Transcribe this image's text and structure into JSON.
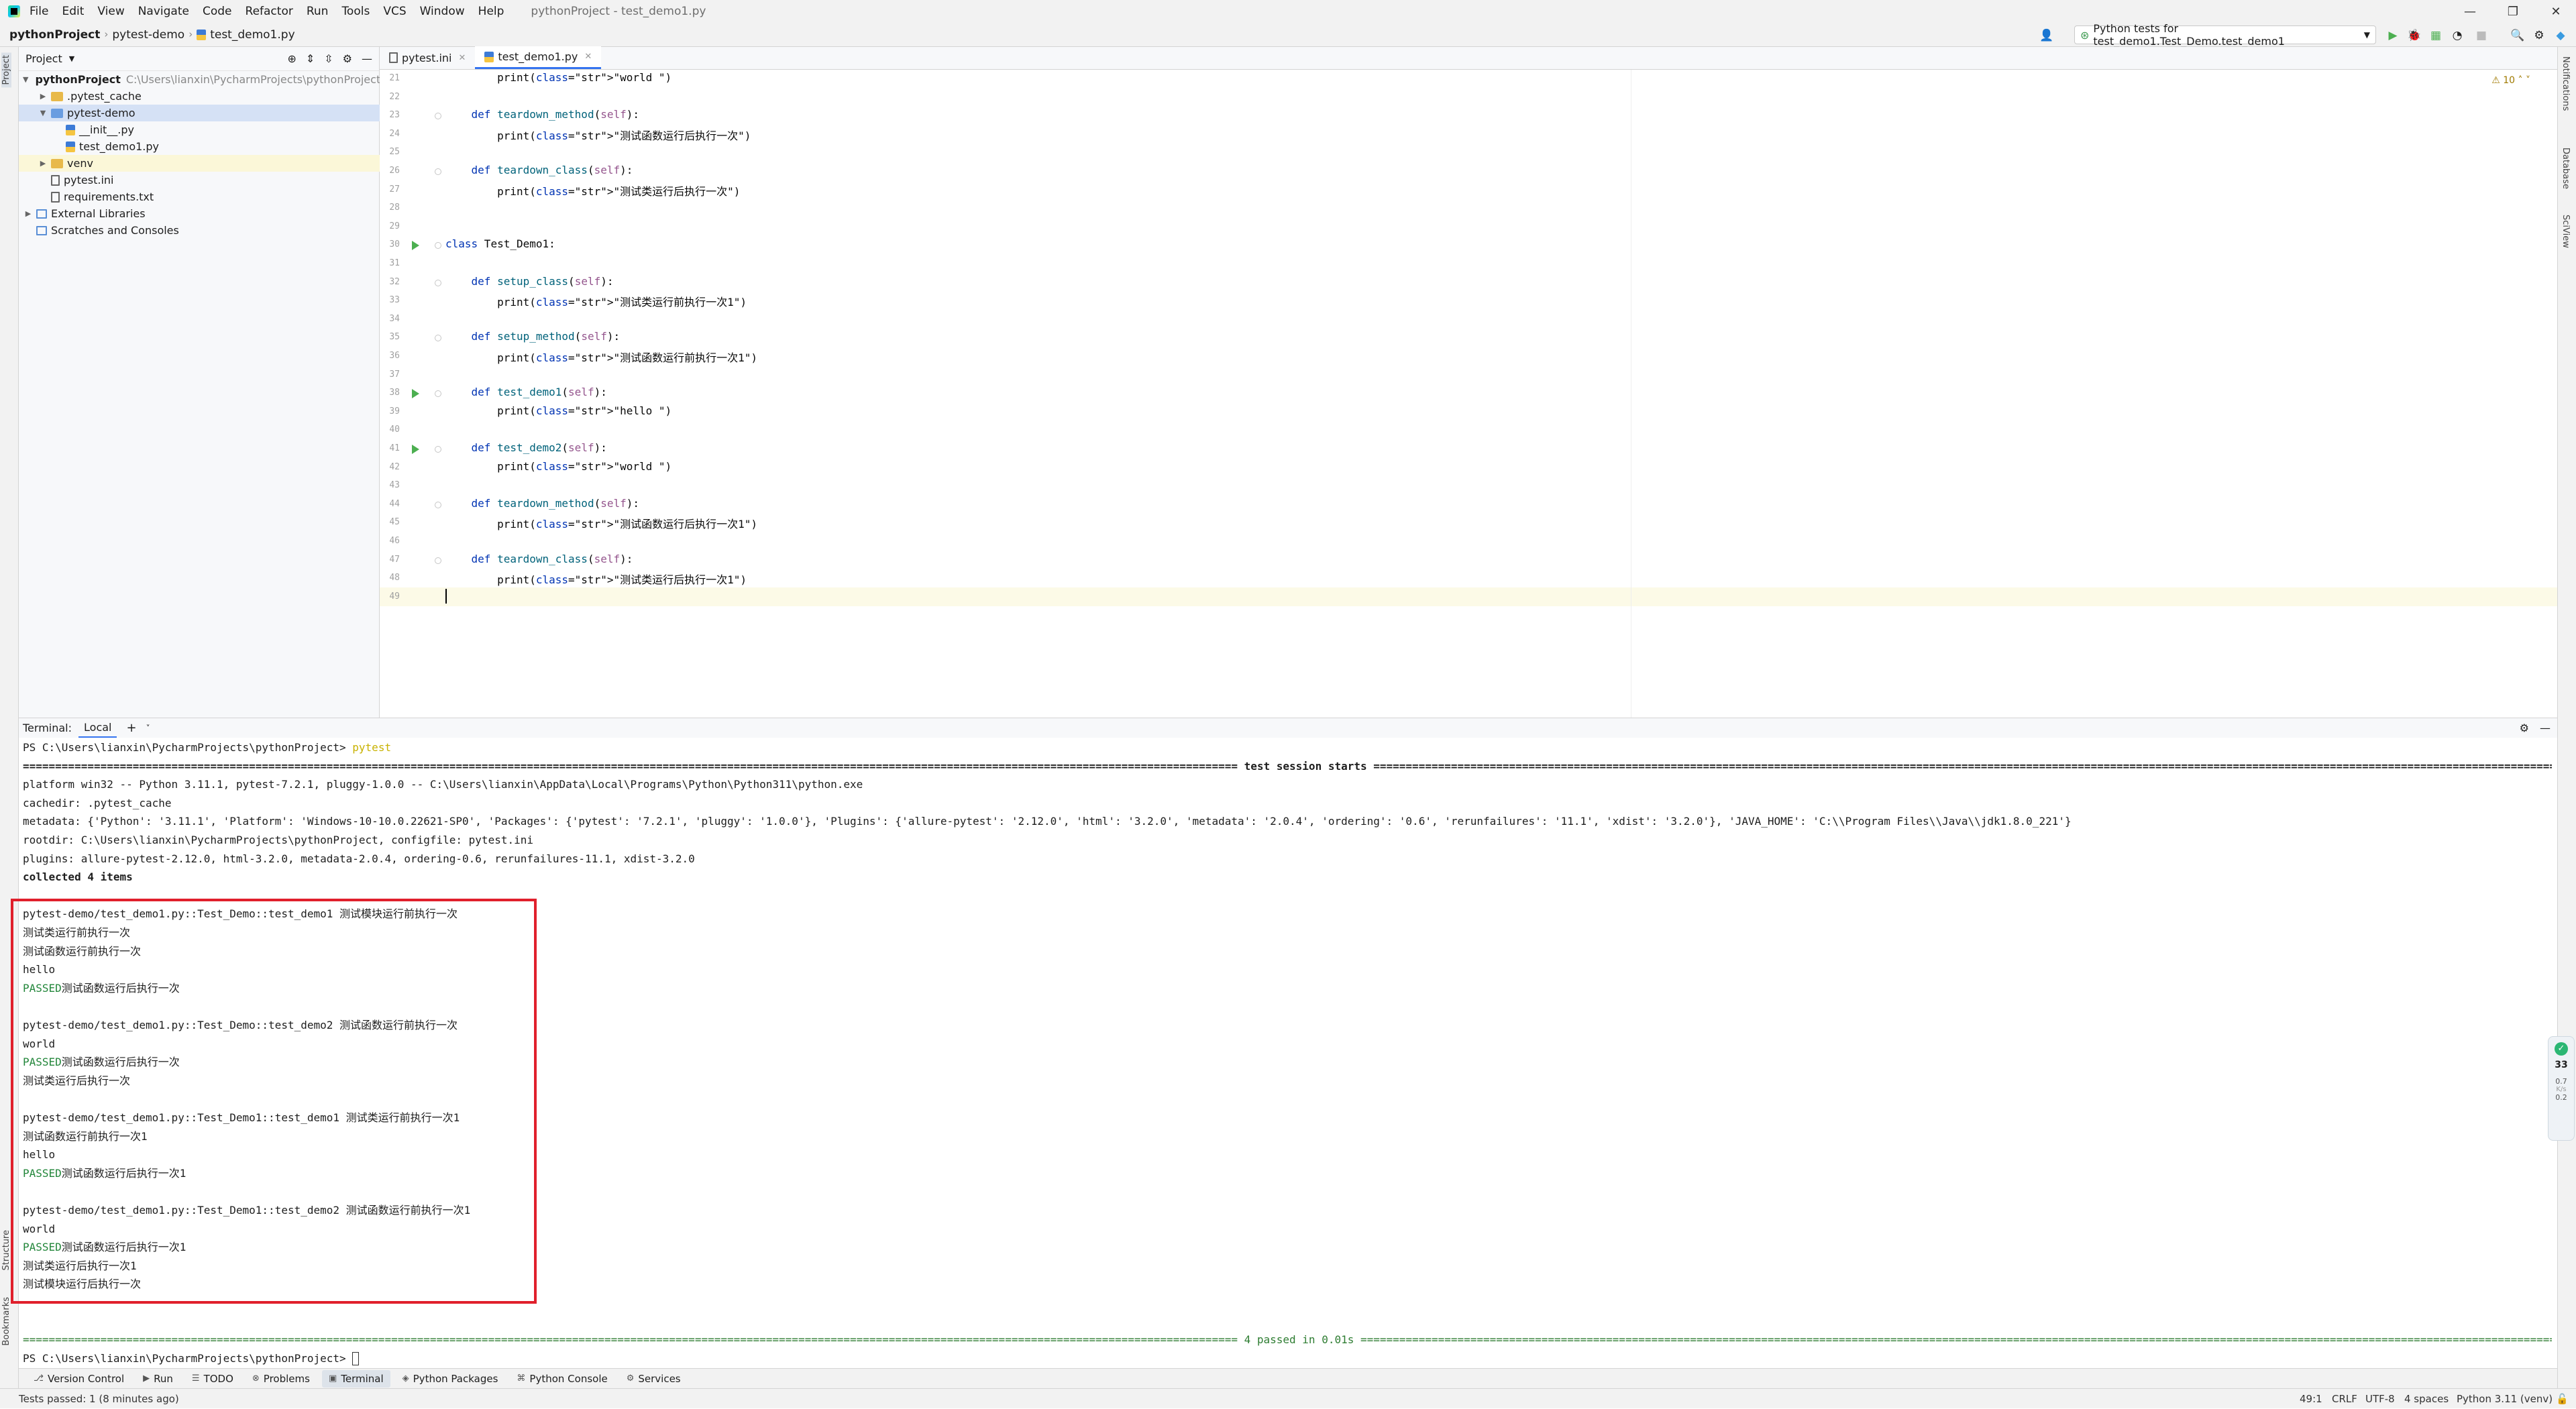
{
  "window": {
    "title": "pythonProject - test_demo1.py",
    "menu": [
      "File",
      "Edit",
      "View",
      "Navigate",
      "Code",
      "Refactor",
      "Run",
      "Tools",
      "VCS",
      "Window",
      "Help"
    ]
  },
  "breadcrumb": [
    "pythonProject",
    "pytest-demo",
    "test_demo1.py"
  ],
  "run_config": "Python tests for test_demo1.Test_Demo.test_demo1",
  "project_panel": {
    "title": "Project",
    "tree": [
      {
        "label": "pythonProject",
        "path": "C:\\Users\\lianxin\\PycharmProjects\\pythonProject",
        "kind": "folder",
        "open": true
      },
      {
        "label": ".pytest_cache",
        "kind": "folder"
      },
      {
        "label": "pytest-demo",
        "kind": "folder",
        "open": true
      },
      {
        "label": "__init__.py",
        "kind": "py"
      },
      {
        "label": "test_demo1.py",
        "kind": "py"
      },
      {
        "label": "venv",
        "kind": "folder"
      },
      {
        "label": "pytest.ini",
        "kind": "ini"
      },
      {
        "label": "requirements.txt",
        "kind": "txt"
      },
      {
        "label": "External Libraries",
        "kind": "lib"
      },
      {
        "label": "Scratches and Consoles",
        "kind": "scratch"
      }
    ]
  },
  "editor": {
    "tabs": [
      {
        "label": "pytest.ini",
        "active": false
      },
      {
        "label": "test_demo1.py",
        "active": true
      }
    ],
    "warnings": "10",
    "lines": [
      {
        "n": "21",
        "code": "        print(\"world \")"
      },
      {
        "n": "22",
        "code": ""
      },
      {
        "n": "23",
        "code": "    def teardown_method(self):"
      },
      {
        "n": "24",
        "code": "        print(\"测试函数运行后执行一次\")"
      },
      {
        "n": "25",
        "code": ""
      },
      {
        "n": "26",
        "code": "    def teardown_class(self):"
      },
      {
        "n": "27",
        "code": "        print(\"测试类运行后执行一次\")"
      },
      {
        "n": "28",
        "code": ""
      },
      {
        "n": "29",
        "code": ""
      },
      {
        "n": "30",
        "code": "class Test_Demo1:"
      },
      {
        "n": "31",
        "code": ""
      },
      {
        "n": "32",
        "code": "    def setup_class(self):"
      },
      {
        "n": "33",
        "code": "        print(\"测试类运行前执行一次1\")"
      },
      {
        "n": "34",
        "code": ""
      },
      {
        "n": "35",
        "code": "    def setup_method(self):"
      },
      {
        "n": "36",
        "code": "        print(\"测试函数运行前执行一次1\")"
      },
      {
        "n": "37",
        "code": ""
      },
      {
        "n": "38",
        "code": "    def test_demo1(self):"
      },
      {
        "n": "39",
        "code": "        print(\"hello \")"
      },
      {
        "n": "40",
        "code": ""
      },
      {
        "n": "41",
        "code": "    def test_demo2(self):"
      },
      {
        "n": "42",
        "code": "        print(\"world \")"
      },
      {
        "n": "43",
        "code": ""
      },
      {
        "n": "44",
        "code": "    def teardown_method(self):"
      },
      {
        "n": "45",
        "code": "        print(\"测试函数运行后执行一次1\")"
      },
      {
        "n": "46",
        "code": ""
      },
      {
        "n": "47",
        "code": "    def teardown_class(self):"
      },
      {
        "n": "48",
        "code": "        print(\"测试类运行后执行一次1\")"
      },
      {
        "n": "49",
        "code": ""
      }
    ]
  },
  "terminal": {
    "label": "Terminal:",
    "tab": "Local",
    "lines": [
      {
        "t": "PS C:\\Users\\lianxin\\PycharmProjects\\pythonProject> ",
        "cmd": "pytest"
      },
      {
        "t": "============================================================================================================================================================================================ test session starts =============================================================================================================================================================================================",
        "bold": true
      },
      {
        "t": "platform win32 -- Python 3.11.1, pytest-7.2.1, pluggy-1.0.0 -- C:\\Users\\lianxin\\AppData\\Local\\Programs\\Python\\Python311\\python.exe"
      },
      {
        "t": "cachedir: .pytest_cache"
      },
      {
        "t": "metadata: {'Python': '3.11.1', 'Platform': 'Windows-10-10.0.22621-SP0', 'Packages': {'pytest': '7.2.1', 'pluggy': '1.0.0'}, 'Plugins': {'allure-pytest': '2.12.0', 'html': '3.2.0', 'metadata': '2.0.4', 'ordering': '0.6', 'rerunfailures': '11.1', 'xdist': '3.2.0'}, 'JAVA_HOME': 'C:\\\\Program Files\\\\Java\\\\jdk1.8.0_221'}"
      },
      {
        "t": "rootdir: C:\\Users\\lianxin\\PycharmProjects\\pythonProject, configfile: pytest.ini"
      },
      {
        "t": "plugins: allure-pytest-2.12.0, html-3.2.0, metadata-2.0.4, ordering-0.6, rerunfailures-11.1, xdist-3.2.0"
      },
      {
        "t": "collected 4 items",
        "bold": true
      },
      {
        "t": ""
      },
      {
        "t": "pytest-demo/test_demo1.py::Test_Demo::test_demo1 测试模块运行前执行一次"
      },
      {
        "t": "测试类运行前执行一次"
      },
      {
        "t": "测试函数运行前执行一次"
      },
      {
        "t": "hello"
      },
      {
        "t": "测试函数运行后执行一次",
        "pass": "PASSED"
      },
      {
        "t": ""
      },
      {
        "t": "pytest-demo/test_demo1.py::Test_Demo::test_demo2 测试函数运行前执行一次"
      },
      {
        "t": "world"
      },
      {
        "t": "测试函数运行后执行一次",
        "pass": "PASSED"
      },
      {
        "t": "测试类运行后执行一次"
      },
      {
        "t": ""
      },
      {
        "t": "pytest-demo/test_demo1.py::Test_Demo1::test_demo1 测试类运行前执行一次1"
      },
      {
        "t": "测试函数运行前执行一次1"
      },
      {
        "t": "hello"
      },
      {
        "t": "测试函数运行后执行一次1",
        "pass": "PASSED"
      },
      {
        "t": ""
      },
      {
        "t": "pytest-demo/test_demo1.py::Test_Demo1::test_demo2 测试函数运行前执行一次1"
      },
      {
        "t": "world"
      },
      {
        "t": "测试函数运行后执行一次1",
        "pass": "PASSED"
      },
      {
        "t": "测试类运行后执行一次1"
      },
      {
        "t": "测试模块运行后执行一次"
      },
      {
        "t": ""
      },
      {
        "t": ""
      },
      {
        "t": "============================================================================================================================================================================================ 4 passed in 0.01s =============================================================================================================================================================================================",
        "green": true
      },
      {
        "t": "PS C:\\Users\\lianxin\\PycharmProjects\\pythonProject> ",
        "cursor": true
      }
    ]
  },
  "tool_windows": [
    {
      "label": "Version Control",
      "icon": "⎇"
    },
    {
      "label": "Run",
      "icon": "▶"
    },
    {
      "label": "TODO",
      "icon": "☰"
    },
    {
      "label": "Problems",
      "icon": "⊗"
    },
    {
      "label": "Terminal",
      "icon": "▣",
      "active": true
    },
    {
      "label": "Python Packages",
      "icon": "◈"
    },
    {
      "label": "Python Console",
      "icon": "⌘"
    },
    {
      "label": "Services",
      "icon": "⚙"
    }
  ],
  "side_tabs": {
    "left": [
      "Project",
      "Bookmarks",
      "Structure"
    ],
    "right": [
      "Notifications",
      "Database",
      "SciView"
    ]
  },
  "status_bar": {
    "message": "Tests passed: 1 (8 minutes ago)",
    "position": "49:1",
    "line_sep": "CRLF",
    "encoding": "UTF-8",
    "indent": "4 spaces",
    "interpreter": "Python 3.11 (venv)"
  },
  "side_widget": {
    "value": "33",
    "line1": "0.7",
    "line2": "0.2",
    "unit": "K/s"
  }
}
